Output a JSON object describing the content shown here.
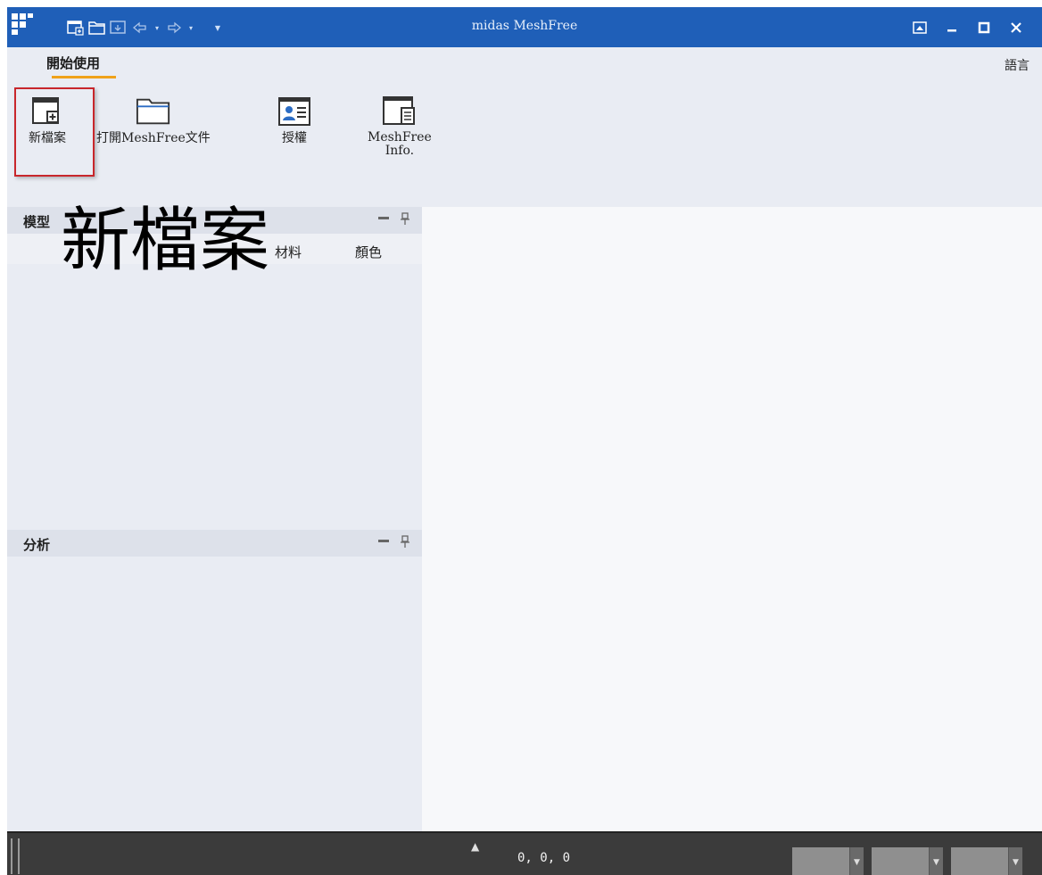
{
  "window": {
    "title": "midas MeshFree"
  },
  "ribbon": {
    "tab_label": "開始使用",
    "language_label": "語言",
    "buttons": [
      {
        "label": "新檔案",
        "icon": "new-file-icon"
      },
      {
        "label": "打開MeshFree文件",
        "icon": "open-folder-icon"
      },
      {
        "label": "授權",
        "icon": "license-icon"
      },
      {
        "label": "MeshFree\nInfo.",
        "icon": "info-document-icon"
      }
    ]
  },
  "model_panel": {
    "title": "模型",
    "columns": {
      "material": "材料",
      "color": "顏色"
    }
  },
  "analysis_panel": {
    "title": "分析"
  },
  "overlay": {
    "text": "新檔案"
  },
  "statusbar": {
    "coords": "0, 0, 0"
  },
  "colors": {
    "titlebar": "#1f5fb8",
    "ribbon": "#e9ecf3",
    "tab_accent": "#f0a21a",
    "highlight": "#c8262b",
    "statusbar": "#3b3b3b"
  }
}
